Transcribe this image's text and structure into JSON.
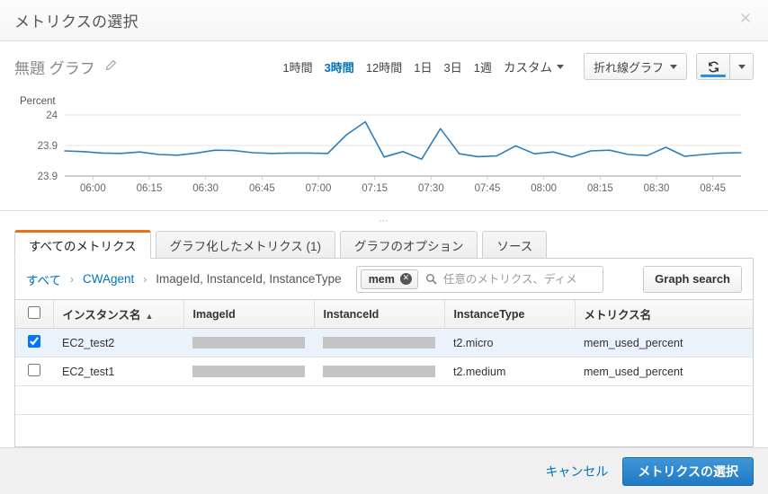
{
  "dialog": {
    "title": "メトリクスの選択",
    "close_icon": "close-icon"
  },
  "graph_header": {
    "graph_title": "無題 グラフ",
    "edit_icon": "pencil-icon",
    "ranges": [
      {
        "label": "1時間",
        "active": false
      },
      {
        "label": "3時間",
        "active": true
      },
      {
        "label": "12時間",
        "active": false
      },
      {
        "label": "1日",
        "active": false
      },
      {
        "label": "3日",
        "active": false
      },
      {
        "label": "1週",
        "active": false
      }
    ],
    "custom_label": "カスタム",
    "graph_type_label": "折れ線グラフ",
    "refresh_icon": "refresh-icon",
    "refresh_caret_icon": "chevron-down-icon"
  },
  "chart_data": {
    "type": "line",
    "title": "",
    "ylabel": "Percent",
    "xlabel": "",
    "grid": true,
    "legend": null,
    "line_color": "#2e7ebb",
    "ylim": [
      23.85,
      24.02
    ],
    "yticks": [
      24,
      23.9,
      23.9
    ],
    "ytick_labels": [
      "24",
      "23.9",
      "23.9"
    ],
    "xtick_labels": [
      "06:00",
      "06:15",
      "06:30",
      "06:45",
      "07:00",
      "07:15",
      "07:30",
      "07:45",
      "08:00",
      "08:15",
      "08:30",
      "08:45"
    ],
    "series": [
      {
        "name": "mem_used_percent",
        "x": [
          "05:50",
          "05:55",
          "06:00",
          "06:05",
          "06:10",
          "06:15",
          "06:20",
          "06:25",
          "06:30",
          "06:35",
          "06:40",
          "06:45",
          "06:50",
          "06:55",
          "07:00",
          "07:05",
          "07:10",
          "07:15",
          "07:20",
          "07:25",
          "07:30",
          "07:35",
          "07:40",
          "07:45",
          "07:50",
          "07:55",
          "08:00",
          "08:05",
          "08:10",
          "08:15",
          "08:20",
          "08:25",
          "08:30",
          "08:35",
          "08:40",
          "08:45",
          "08:50"
        ],
        "values": [
          23.92,
          23.918,
          23.914,
          23.913,
          23.917,
          23.91,
          23.908,
          23.914,
          23.922,
          23.921,
          23.915,
          23.913,
          23.914,
          23.914,
          23.913,
          23.965,
          24.001,
          23.903,
          23.918,
          23.897,
          23.982,
          23.912,
          23.904,
          23.906,
          23.934,
          23.912,
          23.917,
          23.903,
          23.92,
          23.922,
          23.91,
          23.907,
          23.93,
          23.905,
          23.91,
          23.914,
          23.915
        ]
      }
    ]
  },
  "drag_handle": "⋯",
  "tabs": [
    {
      "label": "すべてのメトリクス",
      "active": true
    },
    {
      "label": "グラフ化したメトリクス (1)",
      "active": false
    },
    {
      "label": "グラフのオプション",
      "active": false
    },
    {
      "label": "ソース",
      "active": false
    }
  ],
  "breadcrumb": {
    "items": [
      {
        "label": "すべて",
        "link": true
      },
      {
        "label": "CWAgent",
        "link": true
      },
      {
        "label": "ImageId, InstanceId, InstanceType",
        "link": false
      }
    ],
    "separator": "›"
  },
  "search": {
    "chip_label": "mem",
    "chip_remove_icon": "close-circle-icon",
    "search_icon": "search-icon",
    "placeholder": "任意のメトリクス、ディメ",
    "value": ""
  },
  "graph_search_button": "Graph search",
  "table": {
    "select_all_checked": false,
    "columns": [
      {
        "label": "インスタンス名",
        "sorted": true,
        "sort_icon": "▲"
      },
      {
        "label": "ImageId",
        "sorted": false
      },
      {
        "label": "InstanceId",
        "sorted": false
      },
      {
        "label": "InstanceType",
        "sorted": false
      },
      {
        "label": "メトリクス名",
        "sorted": false
      }
    ],
    "rows": [
      {
        "checked": true,
        "instance_name": "EC2_test2",
        "image_id": "",
        "image_id_redacted": true,
        "instance_id": "",
        "instance_id_redacted": true,
        "instance_type": "t2.micro",
        "metric_name": "mem_used_percent"
      },
      {
        "checked": false,
        "instance_name": "EC2_test1",
        "image_id": "",
        "image_id_redacted": true,
        "instance_id": "",
        "instance_id_redacted": true,
        "instance_type": "t2.medium",
        "metric_name": "mem_used_percent"
      }
    ]
  },
  "footer": {
    "cancel_label": "キャンセル",
    "submit_label": "メトリクスの選択"
  },
  "colors": {
    "accent_blue": "#0073bb",
    "tab_active_orange": "#ec7211",
    "primary_button": "#2179c4",
    "chart_line": "#2e7ebb",
    "row_selected": "#eaf3fb"
  }
}
